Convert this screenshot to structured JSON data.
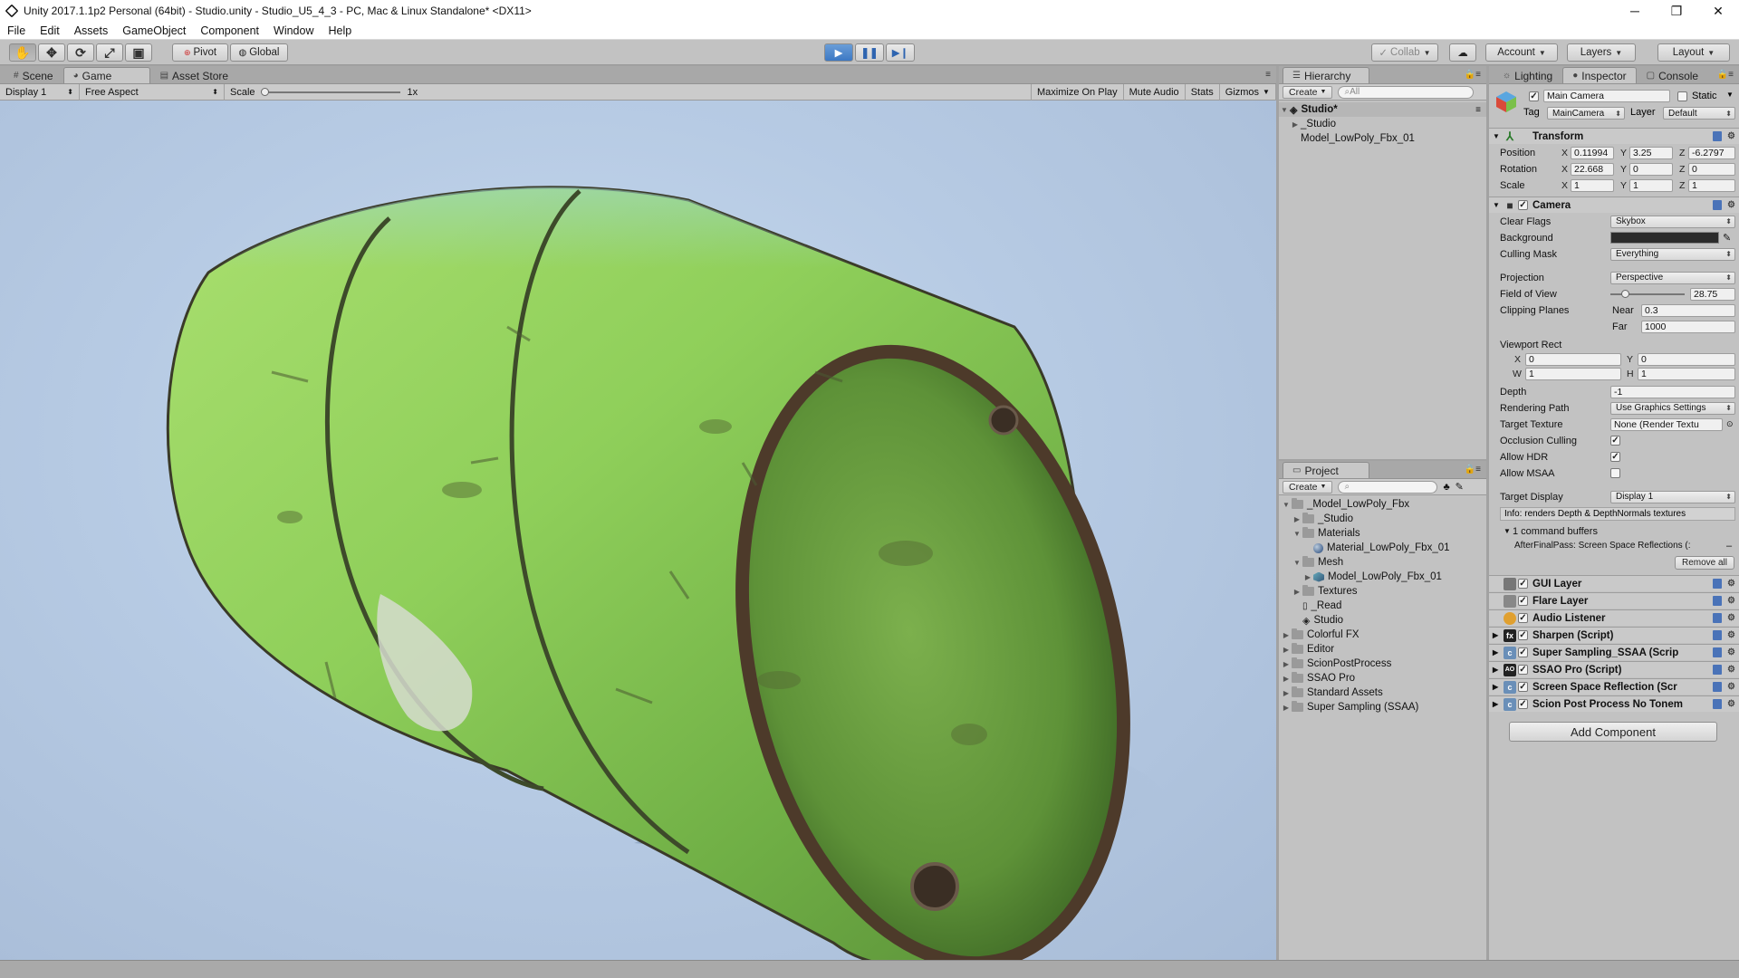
{
  "window": {
    "title": "Unity 2017.1.1p2 Personal (64bit) - Studio.unity - Studio_U5_4_3 - PC, Mac & Linux Standalone* <DX11>",
    "controls": {
      "minimize": "─",
      "maximize": "❐",
      "close": "✕"
    }
  },
  "menu": [
    "File",
    "Edit",
    "Assets",
    "GameObject",
    "Component",
    "Window",
    "Help"
  ],
  "toolbar": {
    "pivot": "Pivot",
    "global": "Global",
    "collab": "Collab",
    "account": "Account",
    "layers": "Layers",
    "layout": "Layout",
    "accent_color": "#3c78c4"
  },
  "scene_panel": {
    "tabs": [
      "Scene",
      "Game",
      "Asset Store"
    ],
    "display": "Display 1",
    "aspect": "Free Aspect",
    "scale_label": "Scale",
    "scale_value": "1x",
    "maximize_on_play": "Maximize On Play",
    "mute_audio": "Mute Audio",
    "stats": "Stats",
    "gizmos": "Gizmos"
  },
  "hierarchy": {
    "tab": "Hierarchy",
    "create": "Create",
    "search_placeholder": "All",
    "scene": "Studio*",
    "items": [
      "_Studio",
      "Model_LowPoly_Fbx_01"
    ]
  },
  "project": {
    "tab": "Project",
    "create": "Create",
    "items": {
      "model_root": "_Model_LowPoly_Fbx",
      "studio": "_Studio",
      "materials": "Materials",
      "material_file": "Material_LowPoly_Fbx_01",
      "mesh": "Mesh",
      "mesh_file": "Model_LowPoly_Fbx_01",
      "textures": "Textures",
      "read": "_Read",
      "studio_scene": "Studio",
      "colorful_fx": "Colorful FX",
      "editor": "Editor",
      "scion": "ScionPostProcess",
      "ssao": "SSAO Pro",
      "standard_assets": "Standard Assets",
      "super_sampling": "Super Sampling (SSAA)"
    }
  },
  "inspector": {
    "tabs": [
      "Lighting",
      "Inspector",
      "Console"
    ],
    "object_name": "Main Camera",
    "static_label": "Static",
    "tag_label": "Tag",
    "tag_value": "MainCamera",
    "layer_label": "Layer",
    "layer_value": "Default",
    "transform": {
      "title": "Transform",
      "position_label": "Position",
      "position": {
        "x": "0.11994",
        "y": "3.25",
        "z": "-6.2797"
      },
      "rotation_label": "Rotation",
      "rotation": {
        "x": "22.668",
        "y": "0",
        "z": "0"
      },
      "scale_label": "Scale",
      "scale": {
        "x": "1",
        "y": "1",
        "z": "1"
      }
    },
    "camera": {
      "title": "Camera",
      "clear_flags_label": "Clear Flags",
      "clear_flags": "Skybox",
      "background_label": "Background",
      "culling_mask_label": "Culling Mask",
      "culling_mask": "Everything",
      "projection_label": "Projection",
      "projection": "Perspective",
      "fov_label": "Field of View",
      "fov": "28.75",
      "clipping_label": "Clipping Planes",
      "near_label": "Near",
      "near": "0.3",
      "far_label": "Far",
      "far": "1000",
      "viewport_label": "Viewport Rect",
      "vp_x": "0",
      "vp_y": "0",
      "vp_w": "1",
      "vp_h": "1",
      "depth_label": "Depth",
      "depth": "-1",
      "rendering_path_label": "Rendering Path",
      "rendering_path": "Use Graphics Settings",
      "target_texture_label": "Target Texture",
      "target_texture": "None (Render Textu",
      "occlusion_label": "Occlusion Culling",
      "hdr_label": "Allow HDR",
      "msaa_label": "Allow MSAA",
      "target_display_label": "Target Display",
      "target_display": "Display 1",
      "info": "Info: renders Depth & DepthNormals textures",
      "command_buffers": "1 command buffers",
      "afterpass": "AfterFinalPass: Screen Space Reflections (:",
      "remove_all": "Remove all"
    },
    "components": [
      "GUI Layer",
      "Flare Layer",
      "Audio Listener",
      "Sharpen (Script)",
      "Super Sampling_SSAA (Scrip",
      "SSAO Pro (Script)",
      "Screen Space Reflection (Scr",
      "Scion Post Process No Tonem"
    ],
    "add_component": "Add Component"
  },
  "colors": {
    "barrel_green": "#8fcf5a",
    "sky": "#b7cbe4"
  }
}
